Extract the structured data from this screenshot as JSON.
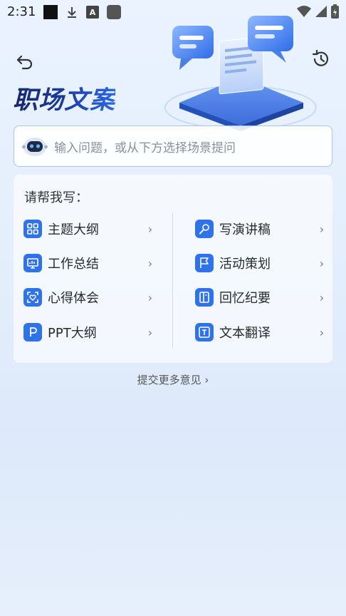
{
  "status_bar": {
    "time": "2:31"
  },
  "header": {
    "title": "职场文案"
  },
  "search": {
    "placeholder": "输入问题，或从下方选择场景提问"
  },
  "card": {
    "title": "请帮我写：",
    "left_items": [
      {
        "label": "主题大纲",
        "icon": "grid-icon"
      },
      {
        "label": "工作总结",
        "icon": "monitor-chart-icon"
      },
      {
        "label": "心得体会",
        "icon": "heart-frame-icon"
      },
      {
        "label": "PPT大纲",
        "icon": "letter-p-icon"
      }
    ],
    "right_items": [
      {
        "label": "写演讲稿",
        "icon": "microphone-icon"
      },
      {
        "label": "活动策划",
        "icon": "flag-icon"
      },
      {
        "label": "回忆纪要",
        "icon": "notebook-icon"
      },
      {
        "label": "文本翻译",
        "icon": "text-t-icon"
      }
    ],
    "chevron": "›"
  },
  "feedback": {
    "label": "提交更多意见 ›"
  },
  "colors": {
    "accent": "#2f73ea",
    "title_dark": "#17266b"
  }
}
